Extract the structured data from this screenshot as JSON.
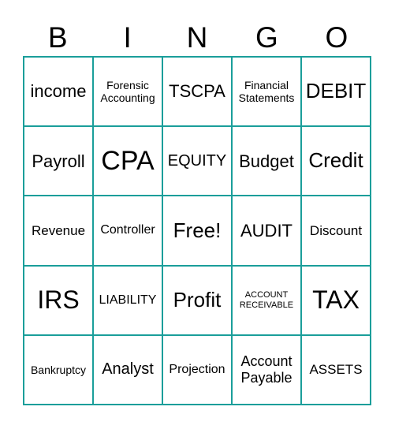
{
  "header": [
    "B",
    "I",
    "N",
    "G",
    "O"
  ],
  "cells": [
    "income",
    "Forensic Accounting",
    "TSCPA",
    "Financial Statements",
    "DEBIT",
    "Payroll",
    "CPA",
    "EQUITY",
    "Budget",
    "Credit",
    "Revenue",
    "Controller",
    "Free!",
    "AUDIT",
    "Discount",
    "IRS",
    "LIABILITY",
    "Profit",
    "ACCOUNT RECEIVABLE",
    "TAX",
    "Bankruptcy",
    "Analyst",
    "Projection",
    "Account Payable",
    "ASSETS"
  ],
  "colors": {
    "border": "#1a9e9a"
  }
}
